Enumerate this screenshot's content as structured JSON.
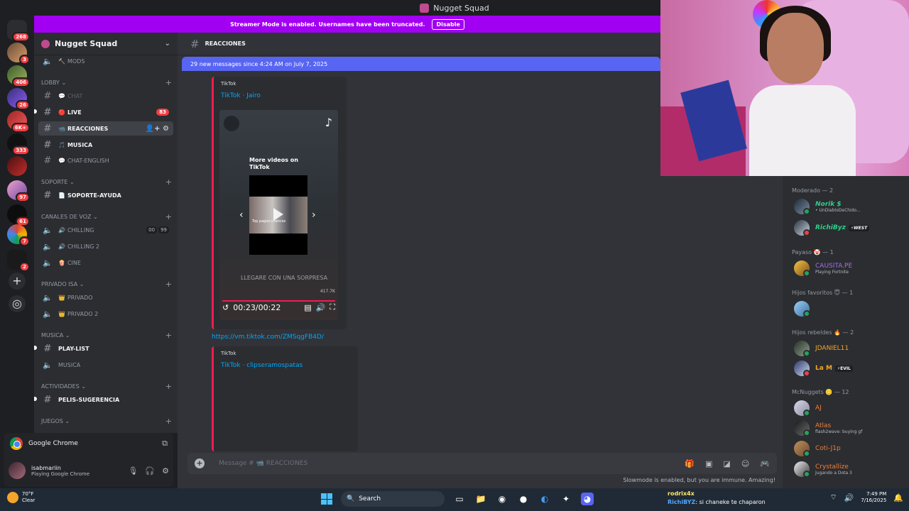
{
  "window": {
    "title": "Nugget Squad"
  },
  "banner": {
    "text": "Streamer Mode is enabled. Usernames have been truncated.",
    "disable": "Disable"
  },
  "servers": {
    "badges": [
      "268",
      "3",
      "406",
      "26",
      "6K+",
      "333",
      "97",
      "61",
      "7",
      "2"
    ]
  },
  "sidebar": {
    "server_name": "Nugget Squad",
    "channels": [
      {
        "name": "MODS",
        "type": "voice",
        "icon": "🔨"
      },
      {
        "category": "LOBBY"
      },
      {
        "name": "CHAT",
        "type": "text",
        "icon": "💬",
        "muted": true
      },
      {
        "name": "LIVE",
        "type": "text",
        "icon": "🔴",
        "badge": "83"
      },
      {
        "name": "REACCIONES",
        "type": "text",
        "icon": "📹",
        "active": true
      },
      {
        "name": "MUSICA",
        "type": "text",
        "icon": "🎵"
      },
      {
        "name": "CHAT-ENGLISH",
        "type": "text",
        "icon": "💬"
      },
      {
        "category": "SOPORTE"
      },
      {
        "name": "SOPORTE-AYUDA",
        "type": "text",
        "icon": "📄"
      },
      {
        "category": "CANALES DE VOZ"
      },
      {
        "name": "CHILLING",
        "type": "voice",
        "icon": "🔊",
        "counts": [
          "00",
          "99"
        ]
      },
      {
        "name": "CHILLING 2",
        "type": "voice",
        "icon": "🔊"
      },
      {
        "name": "CINE",
        "type": "voice",
        "icon": "🍿"
      },
      {
        "category": "PRIVADO ISA"
      },
      {
        "name": "PRIVADO",
        "type": "voice",
        "icon": "👑"
      },
      {
        "name": "PRIVADO 2",
        "type": "voice",
        "icon": "👑"
      },
      {
        "category": "MUSICA"
      },
      {
        "name": "PLAY-LIST",
        "type": "text"
      },
      {
        "name": "MUSICA",
        "type": "voice"
      },
      {
        "category": "ACTIVIDADES"
      },
      {
        "name": "PELIS-SUGERENCIA",
        "type": "text"
      },
      {
        "category": "JUEGOS"
      }
    ]
  },
  "app_panel": {
    "label": "Google Chrome"
  },
  "user_panel": {
    "name": "isabmariin",
    "status": "Playing Google Chrome"
  },
  "chat": {
    "channel": "REACCIONES",
    "new_messages": "29 new messages since 4:24 AM on July 7, 2025",
    "embed1": {
      "provider": "TikTok",
      "title": "TikTok · Jairo"
    },
    "video": {
      "more_videos": "More videos on TikTok",
      "caption": "LLEGARE CON UNA SORPRESA",
      "thumb_caption": "Top pagos chances",
      "views": "417.7K",
      "time": "00:23/00:22"
    },
    "link": "https://vm.tiktok.com/ZMSqgFB4D/",
    "embed2": {
      "provider": "TikTok",
      "title": "TikTok · clipseramospatas"
    },
    "composer_placeholder": "Message # 📹 REACCIONES",
    "slowmode": "Slowmode is enabled, but you are immune. Amazing!"
  },
  "members": {
    "groups": [
      {
        "label": "Moderado",
        "count": "— 2"
      },
      {
        "label": "Payaso 🤡",
        "count": "— 1"
      },
      {
        "label": "Hijos favoritos 😇",
        "count": "— 1"
      },
      {
        "label": "Hijos rebeldes 🔥",
        "count": "— 2"
      },
      {
        "label": "McNuggets 🪙",
        "count": "— 12"
      }
    ],
    "list": [
      {
        "name": "Norik $",
        "activity": "• UnDiabloDeChido...",
        "color": "#2dd08a"
      },
      {
        "name": "RichiByz",
        "tag": "⚡WEST",
        "color": "#2dd08a"
      },
      {
        "name": "CAUSITA.PE",
        "activity": "Playing Fortnite",
        "color": "#a66cf0"
      },
      {
        "name": "JDANIEL11",
        "color": "#f5a623"
      },
      {
        "name": "La M",
        "tag": "⚡EVIL",
        "color": "#f5a623"
      },
      {
        "name": "AJ",
        "color": "#f07e38"
      },
      {
        "name": "Atlas",
        "activity": "flash2wave: buying gf",
        "color": "#f07e38"
      },
      {
        "name": "Coti-J1p",
        "color": "#f07e38"
      },
      {
        "name": "Crystallize",
        "activity": "Jugando a Dota 3",
        "color": "#f07e38"
      }
    ]
  },
  "taskbar": {
    "weather_temp": "70°F",
    "weather_desc": "Clear",
    "search": "Search",
    "time": "7:49 PM",
    "date": "7/16/2025",
    "ticker_user1": "rodrix4x",
    "ticker_user2": "RichiBYZ",
    "ticker_msg": ": si chaneke te chaparon"
  }
}
